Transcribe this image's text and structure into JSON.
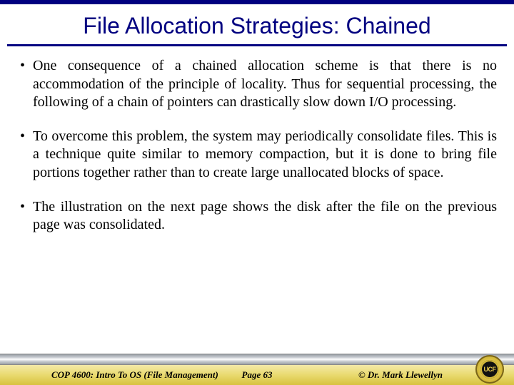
{
  "title": "File Allocation Strategies: Chained",
  "bullets": [
    "One consequence of a chained allocation scheme is that there is no accommodation of the principle of locality. Thus for sequential processing, the following of a chain of pointers can drastically slow down I/O processing.",
    "To overcome this problem, the system may periodically consolidate files. This is a technique quite similar to memory compaction, but it is done to bring file portions together rather than to create large unallocated blocks of space.",
    "The illustration on the next page shows the disk after the file on the previous page was consolidated."
  ],
  "footer": {
    "left": "COP 4600: Intro To OS  (File Management)",
    "center": "Page 63",
    "right": "© Dr. Mark Llewellyn"
  },
  "seal_text": "UCF"
}
